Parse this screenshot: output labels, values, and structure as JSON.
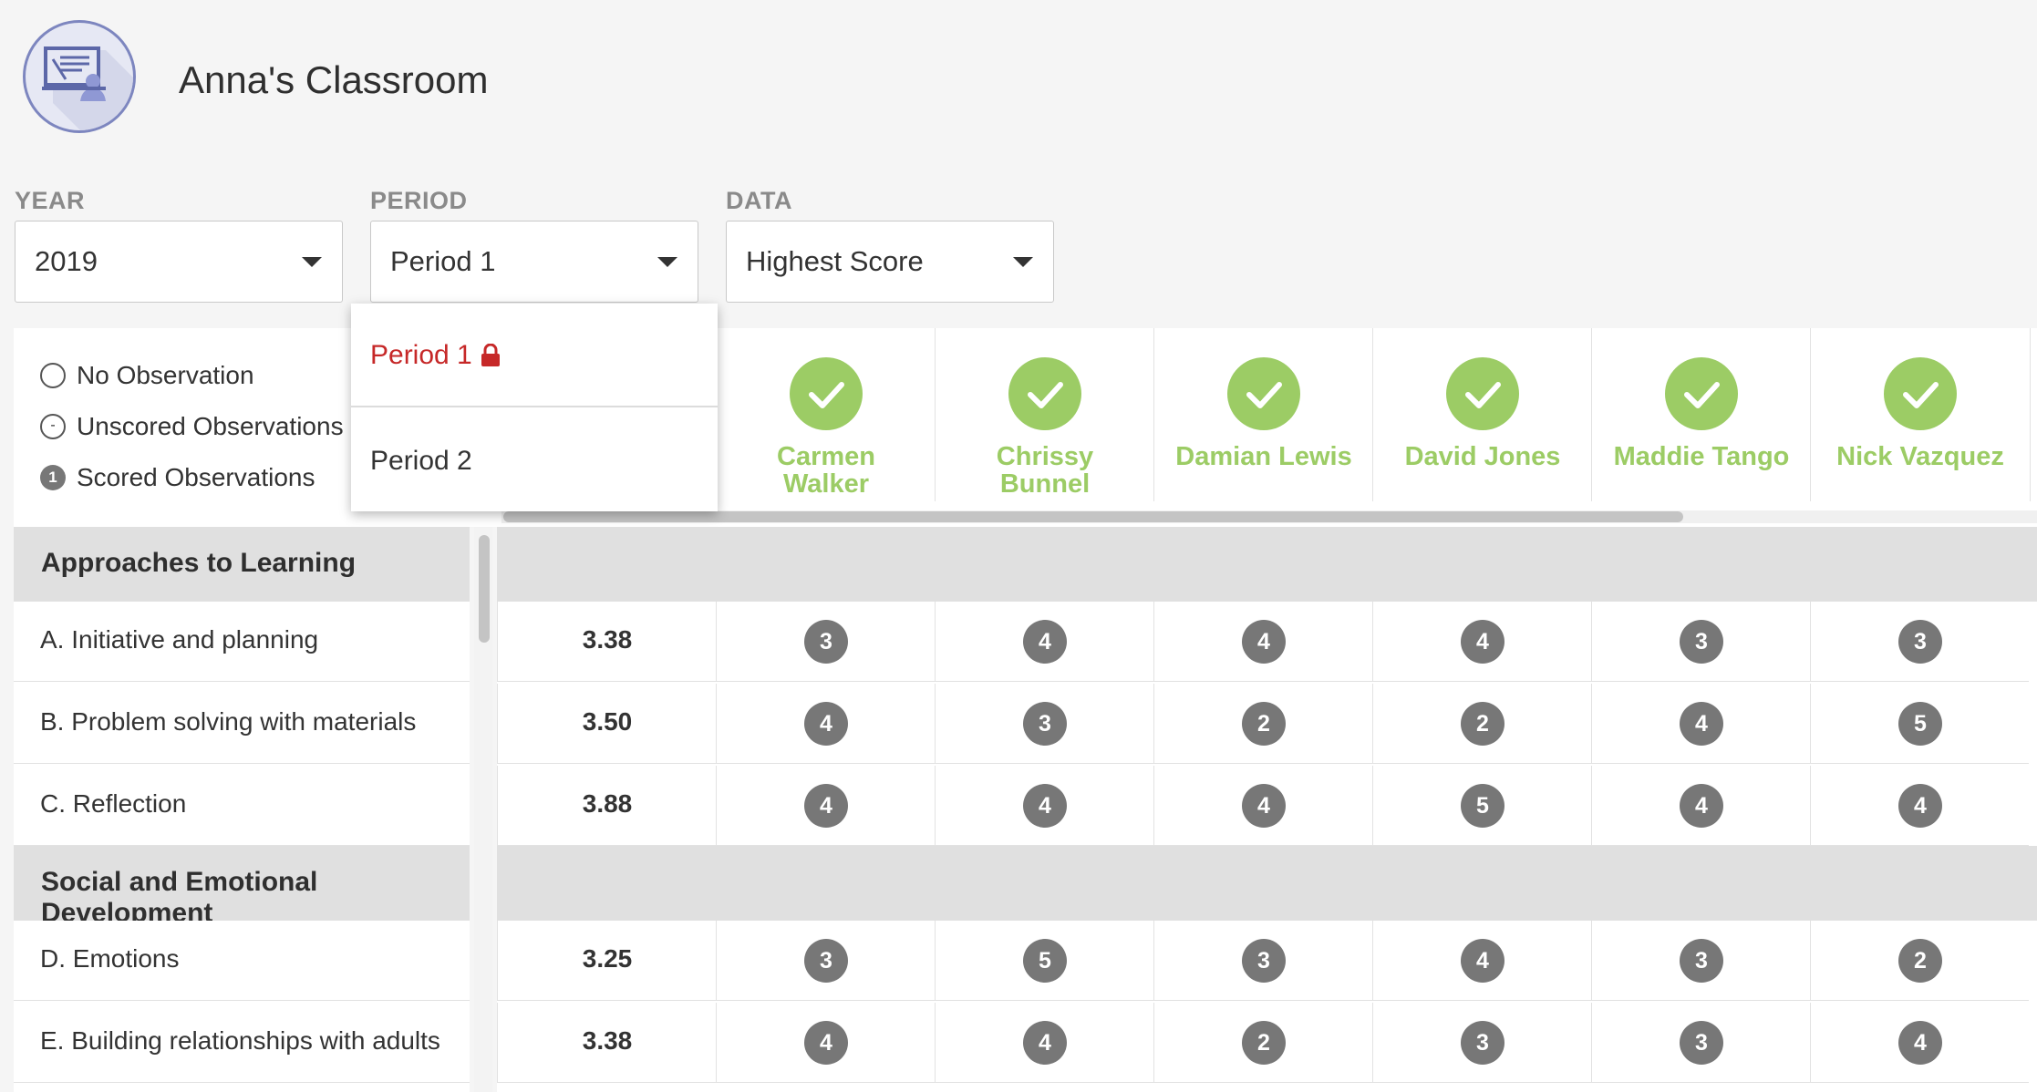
{
  "header": {
    "title": "Anna's Classroom",
    "icon": "classroom-teacher-icon"
  },
  "filters": {
    "year": {
      "label": "YEAR",
      "value": "2019"
    },
    "period": {
      "label": "PERIOD",
      "value": "Period 1"
    },
    "data": {
      "label": "DATA",
      "value": "Highest Score"
    }
  },
  "period_dropdown": {
    "options": [
      {
        "label": "Period 1",
        "locked": true,
        "selected": true
      },
      {
        "label": "Period 2",
        "locked": false,
        "selected": false
      }
    ]
  },
  "legend": {
    "no_observation": "No Observation",
    "unscored": "Unscored Observations",
    "unscored_symbol": "-",
    "scored": "Scored Observations",
    "scored_symbol": "1"
  },
  "students": [
    {
      "name_line1": "Carmen",
      "name_line2": "Walker"
    },
    {
      "name_line1": "Chrissy",
      "name_line2": "Bunnel"
    },
    {
      "name_line1": "Damian Lewis",
      "name_line2": ""
    },
    {
      "name_line1": "David Jones",
      "name_line2": ""
    },
    {
      "name_line1": "Maddie Tango",
      "name_line2": ""
    },
    {
      "name_line1": "Nick Vazquez",
      "name_line2": ""
    }
  ],
  "sections": [
    {
      "title": "Approaches to Learning",
      "rows": [
        {
          "label": "A. Initiative and planning",
          "avg": "3.38",
          "scores": [
            "3",
            "4",
            "4",
            "4",
            "3",
            "3"
          ]
        },
        {
          "label": "B. Problem solving with materials",
          "avg": "3.50",
          "scores": [
            "4",
            "3",
            "2",
            "2",
            "4",
            "5"
          ]
        },
        {
          "label": "C. Reflection",
          "avg": "3.88",
          "scores": [
            "4",
            "4",
            "4",
            "5",
            "4",
            "4"
          ]
        }
      ]
    },
    {
      "title": "Social and Emotional Development",
      "rows": [
        {
          "label": "D. Emotions",
          "avg": "3.25",
          "scores": [
            "3",
            "5",
            "3",
            "4",
            "3",
            "2"
          ]
        },
        {
          "label": "E. Building relationships with adults",
          "avg": "3.38",
          "scores": [
            "4",
            "4",
            "2",
            "3",
            "3",
            "4"
          ]
        }
      ]
    }
  ],
  "colors": {
    "accent_green": "#9ccc65",
    "locked_red": "#c62828",
    "badge_gray": "#777777",
    "section_gray": "#e0e0e0"
  }
}
